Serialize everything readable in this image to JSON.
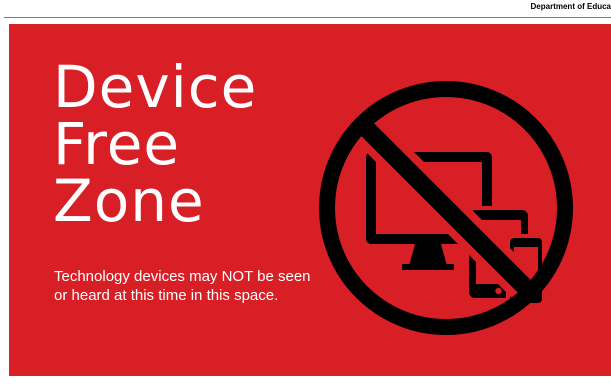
{
  "header": {
    "department": "Department of Educa"
  },
  "sign": {
    "headline_lines": [
      "Device",
      "Free",
      "Zone"
    ],
    "subtext_lines": [
      "Technology devices may NOT be seen",
      "or heard at this time in this space."
    ],
    "icon": "no-devices-icon"
  },
  "colors": {
    "background": "#d81f26",
    "text": "#ffffff",
    "icon": "#000000"
  }
}
